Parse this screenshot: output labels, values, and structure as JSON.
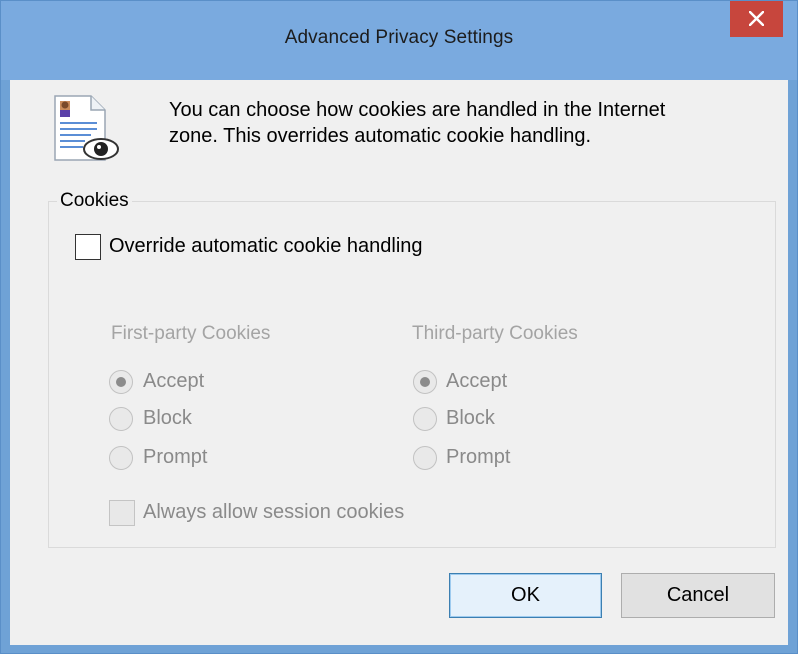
{
  "window": {
    "title": "Advanced Privacy Settings"
  },
  "intro_text_line1": "You can choose how cookies are handled in the Internet",
  "intro_text_line2": "zone.  This overrides automatic cookie handling.",
  "cookies_group": {
    "label": "Cookies",
    "override_label": "Override automatic cookie handling",
    "override_checked": false,
    "first_party": {
      "heading": "First-party Cookies",
      "options": [
        "Accept",
        "Block",
        "Prompt"
      ],
      "selected": "Accept"
    },
    "third_party": {
      "heading": "Third-party Cookies",
      "options": [
        "Accept",
        "Block",
        "Prompt"
      ],
      "selected": "Accept"
    },
    "session_label": "Always allow session cookies",
    "session_checked": false
  },
  "buttons": {
    "ok": "OK",
    "cancel": "Cancel"
  },
  "colors": {
    "titlebar": "#7aaadf",
    "close": "#c7463d",
    "client": "#f0f0f0"
  }
}
